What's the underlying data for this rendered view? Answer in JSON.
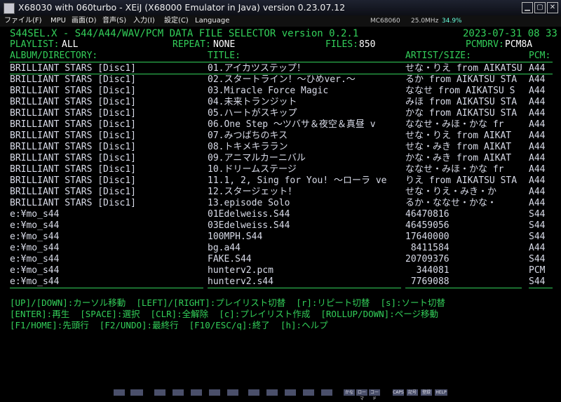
{
  "window": {
    "title": "X68030 with 060turbo - XEiJ (X68000 Emulator in Java) version 0.23.07.12"
  },
  "menu": {
    "items": [
      "ファイル(F)",
      "MPU",
      "画面(D)",
      "音声(S)",
      "入力(I)",
      "設定(C)",
      "Language"
    ],
    "cpu": "MC68060",
    "freq": "25.0MHz",
    "load": "34.9%"
  },
  "app": {
    "heading": "S44SEL.X - S44/A44/WAV/PCM DATA FILE SELECTOR version 0.2.1",
    "datetime": "2023-07-31 08 33",
    "playlist_label": "PLAYLIST:",
    "playlist_value": "ALL",
    "repeat_label": "REPEAT:",
    "repeat_value": "NONE",
    "files_label": "FILES:",
    "files_value": "850",
    "pcmdrv_label": "PCMDRV:",
    "pcmdrv_value": "PCM8A",
    "col_album": "ALBUM/DIRECTORY:",
    "col_title": "TITLE:",
    "col_artist": "ARTIST/SIZE:",
    "col_pcm": "PCM:"
  },
  "rows": [
    {
      "album": "BRILLIANT STARS [Disc1]",
      "title": "01.アイカツステップ！",
      "artist": "せな・りえ from AIKATSU",
      "pcm": "A44"
    },
    {
      "album": "BRILLIANT STARS [Disc1]",
      "title": "02.スタートライン！～ひめver.～",
      "artist": "るか from AIKATSU STA",
      "pcm": "A44"
    },
    {
      "album": "BRILLIANT STARS [Disc1]",
      "title": "03.Miracle Force Magic",
      "artist": "ななせ from AIKATSU S",
      "pcm": "A44"
    },
    {
      "album": "BRILLIANT STARS [Disc1]",
      "title": "04.未来トランジット",
      "artist": "みほ from AIKATSU STA",
      "pcm": "A44"
    },
    {
      "album": "BRILLIANT STARS [Disc1]",
      "title": "05.ハートがスキップ",
      "artist": "かな from AIKATSU STA",
      "pcm": "A44"
    },
    {
      "album": "BRILLIANT STARS [Disc1]",
      "title": "06.One Step ～ツバサ＆夜空＆真昼 v",
      "artist": "ななせ・みほ・かな fr",
      "pcm": "A44"
    },
    {
      "album": "BRILLIANT STARS [Disc1]",
      "title": "07.みつばちのキス",
      "artist": "せな・りえ from AIKAT",
      "pcm": "A44"
    },
    {
      "album": "BRILLIANT STARS [Disc1]",
      "title": "08.トキメキララン",
      "artist": "せな・みき from AIKAT",
      "pcm": "A44"
    },
    {
      "album": "BRILLIANT STARS [Disc1]",
      "title": "09.アニマルカーニバル",
      "artist": "かな・みき from AIKAT",
      "pcm": "A44"
    },
    {
      "album": "BRILLIANT STARS [Disc1]",
      "title": "10.ドリームステージ",
      "artist": "ななせ・みほ・かな fr",
      "pcm": "A44"
    },
    {
      "album": "BRILLIANT STARS [Disc1]",
      "title": "11.1, 2, Sing for You! ～ローラ ve",
      "artist": "りえ from AIKATSU STA",
      "pcm": "A44"
    },
    {
      "album": "BRILLIANT STARS [Disc1]",
      "title": "12.スタージェット！",
      "artist": "せな・りえ・みき・か",
      "pcm": "A44"
    },
    {
      "album": "BRILLIANT STARS [Disc1]",
      "title": "13.episode Solo",
      "artist": "るか・ななせ・かな・",
      "pcm": "A44"
    },
    {
      "album": "e:¥mo_s44",
      "title": "01Edelweiss.S44",
      "artist": "46470816",
      "pcm": "S44"
    },
    {
      "album": "e:¥mo_s44",
      "title": "03Edelweiss.S44",
      "artist": "46459056",
      "pcm": "S44"
    },
    {
      "album": "e:¥mo_s44",
      "title": "100MPH.S44",
      "artist": "17640000",
      "pcm": "S44"
    },
    {
      "album": "e:¥mo_s44",
      "title": "bg.a44",
      "artist": " 8411584",
      "pcm": "A44"
    },
    {
      "album": "e:¥mo_s44",
      "title": "FAKE.S44",
      "artist": "20709376",
      "pcm": "S44"
    },
    {
      "album": "e:¥mo_s44",
      "title": "hunterv2.pcm",
      "artist": "  344081",
      "pcm": "PCM"
    },
    {
      "album": "e:¥mo_s44",
      "title": "hunterv2.s44",
      "artist": " 7769088",
      "pcm": "S44"
    }
  ],
  "help": [
    "[UP]/[DOWN]:カーソル移動  [LEFT]/[RIGHT]:プレイリスト切替  [r]:リピート切替  [s]:ソート切替",
    "[ENTER]:再生  [SPACE]:選択  [CLR]:全解除  [c]:プレイリスト作成  [ROLLUP/DOWN]:ページ移動",
    "[F1/HOME]:先頭行  [F2/UNDO]:最終行  [F10/ESC/q]:終了  [h]:ヘルプ"
  ],
  "fkeys": [
    "かな",
    "ローマ",
    "コード",
    "CAPS",
    "記号",
    "登録",
    "HELP"
  ],
  "colors": {
    "accent": "#33d05a",
    "text": "#cfd2e0",
    "background": "#000000"
  }
}
